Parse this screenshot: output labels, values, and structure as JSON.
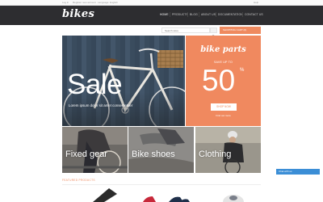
{
  "topbar": {
    "links": [
      "Log in",
      "Register new account",
      "Language: English"
    ],
    "right": "Help"
  },
  "header": {
    "logo": "bikes",
    "nav": [
      "HOME",
      "PRODUCTS",
      "BLOG",
      "ABOUT US",
      "DOCUMENTATION",
      "CONTACT US"
    ],
    "active_index": 0
  },
  "search": {
    "placeholder": "Search store",
    "cart_label": "SHOPPING CART (0)"
  },
  "hero": {
    "title": "Sale",
    "subtitle": "Lorem ipsum dolor sit amet consectetuer"
  },
  "promo": {
    "title": "bike parts",
    "save_text": "SAVE UP TO",
    "value": "50",
    "unit": "%",
    "button": "SHOP NOW",
    "link": "Find out more"
  },
  "tiles": [
    {
      "label": "Fixed gear"
    },
    {
      "label": "Bike shoes"
    },
    {
      "label": "Clothing"
    }
  ],
  "featured": {
    "heading": "FEATURED PRODUCTS"
  },
  "chat": {
    "label": "Chat with us"
  },
  "colors": {
    "accent": "#ef8a5f",
    "header_bg": "#2d2d30",
    "chat_bg": "#3b8ed6"
  }
}
